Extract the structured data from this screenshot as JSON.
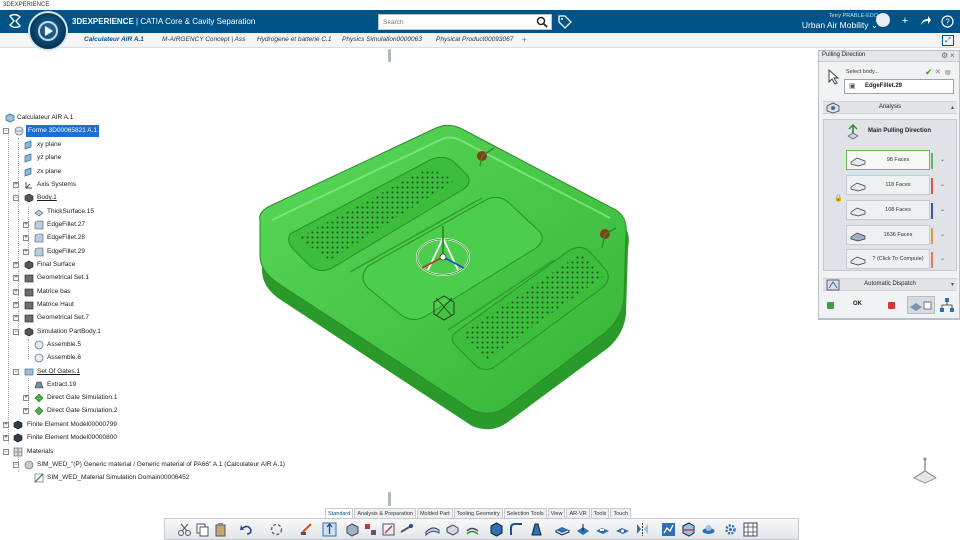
{
  "window": {
    "title": "3DEXPERIENCE"
  },
  "header": {
    "brand_bold": "3DEXPERIENCE",
    "brand_rest": " | CATIA Core & Cavity Separation",
    "search_placeholder": "Search",
    "user_name": "Terry PRABLE-EDO",
    "collab_space": "Urban Air Mobility"
  },
  "tabs": [
    {
      "label": "Calculateur AIR A.1",
      "active": true
    },
    {
      "label": "M-AIRGENCY Concept | Ass"
    },
    {
      "label": "Hydrogene et batterie C.1"
    },
    {
      "label": "Physics Simulation0000063"
    },
    {
      "label": "Physical Product00093067"
    }
  ],
  "tab_add": "+",
  "tree": {
    "nodes": [
      {
        "label": "Calculateur AIR A.1"
      },
      {
        "label": "Forme 3D00065821 A.1"
      },
      {
        "label": "xy plane"
      },
      {
        "label": "yz plane"
      },
      {
        "label": "zx plane"
      },
      {
        "label": "Axis Systems"
      },
      {
        "label": "Body.1"
      },
      {
        "label": "ThickSurface.15"
      },
      {
        "label": "EdgeFillet.27"
      },
      {
        "label": "EdgeFillet.28"
      },
      {
        "label": "EdgeFillet.29"
      },
      {
        "label": "Final Surface"
      },
      {
        "label": "Geometrical Set.1"
      },
      {
        "label": "Matrice bas"
      },
      {
        "label": "Matrice Haut"
      },
      {
        "label": "Geometrical Set.7"
      },
      {
        "label": "Simulation PartBody.1"
      },
      {
        "label": "Assemble.5"
      },
      {
        "label": "Assemble.6"
      },
      {
        "label": "Set Of Gates.1"
      },
      {
        "label": "Extract.19"
      },
      {
        "label": "Direct Gate Simulation.1"
      },
      {
        "label": "Direct Gate Simulation.2"
      },
      {
        "label": "Finite Element Model00000799"
      },
      {
        "label": "Finite Element Model00000800"
      },
      {
        "label": "Materials"
      },
      {
        "label": "SIM_WED_\"(P)  Generic material / Generic material of PA66\" A.1 (Calculateur AIR A.1)"
      },
      {
        "label": "SIM_WED_Material Simulation Domain00006452"
      }
    ]
  },
  "action_bar": {
    "tabs": [
      "Standard",
      "Analysis & Preparation",
      "Molded Part",
      "Tooling Geometry",
      "Selection Tools",
      "View",
      "AR-VR",
      "Tools",
      "Touch"
    ],
    "active_tab": "Standard"
  },
  "panel": {
    "title": "Pulling Direction",
    "select_label": "Select body...",
    "selected_body": "EdgeFillet.29",
    "analysis_label": "Analysis",
    "main_direction_label": "Main Pulling Direction",
    "faces": [
      {
        "label": "98 Faces",
        "color": "#5cb85c"
      },
      {
        "label": "118 Faces",
        "color": "#d9534f"
      },
      {
        "label": "108 Faces",
        "color": "#3f51b5"
      },
      {
        "label": "1636 Faces",
        "color": "#e09a3e"
      },
      {
        "label": "? (Click To Compute)",
        "color": "#e07a5f"
      }
    ],
    "auto_dispatch_label": "Automatic Dispatch",
    "ok_label": "OK"
  },
  "colors": {
    "brand_blue": "#005386",
    "part_green": "#3fbf3f",
    "selection_blue": "#1d6fd1"
  }
}
